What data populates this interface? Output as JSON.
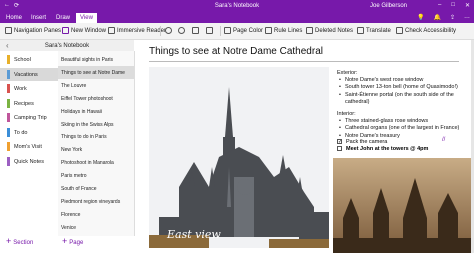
{
  "titlebar": {
    "title": "Sara's Notebook",
    "user": "Joe Gilberson"
  },
  "tabs": [
    {
      "label": "Home"
    },
    {
      "label": "Insert"
    },
    {
      "label": "Draw"
    },
    {
      "label": "View"
    }
  ],
  "ribbon": {
    "navigation_panes": "Navigation Panes",
    "new_window": "New Window",
    "immersive_reader": "Immersive Reader",
    "page_color": "Page Color",
    "rule_lines": "Rule Lines",
    "deleted_notes": "Deleted Notes",
    "translate": "Translate",
    "check_accessibility": "Check Accessibility"
  },
  "notebook": {
    "name": "Sara's Notebook"
  },
  "sections": [
    {
      "label": "School",
      "color": "#e8b02a"
    },
    {
      "label": "Vacations",
      "color": "#5b9bd5"
    },
    {
      "label": "Work",
      "color": "#d9534f"
    },
    {
      "label": "Recipes",
      "color": "#7bb342"
    },
    {
      "label": "Camping Trip",
      "color": "#c0569b"
    },
    {
      "label": "To do",
      "color": "#3b8ed8"
    },
    {
      "label": "Mom's Visit",
      "color": "#f0a030"
    },
    {
      "label": "Quick Notes",
      "color": "#9c5fc2"
    }
  ],
  "pages": [
    "Beautiful sights in Paris",
    "Things to see at Notre Dame",
    "The Louvre",
    "Eiffel Tower photoshoot",
    "Holidays in Hawaii",
    "Skiing in the Swiss Alps",
    "Things to do in Paris",
    "New York",
    "Photoshoot in Manarola",
    "Paris metro",
    "South of France",
    "Piedmont region vineyards",
    "Florence",
    "Venice"
  ],
  "bottom": {
    "add_section": "Section",
    "add_page": "Page"
  },
  "page": {
    "title": "Things to see at Notre Dame Cathedral",
    "photo_caption": "East view",
    "exterior_heading": "Exterior:",
    "exterior_items": [
      "Notre Dame's west rose window",
      "South tower 13-ton bell (home of Quasimodo!)",
      "Saint-Étienne portal (on the south side of the cathedral)"
    ],
    "interior_heading": "Interior:",
    "interior_items": [
      "Three stained-glass rose windows",
      "Cathedral organs (one of the largest in France)",
      "Notre Dame's treasury"
    ],
    "todos": [
      {
        "label": "Pack the camera",
        "checked": true
      },
      {
        "label": "Meet John at the towers @ 4pm",
        "checked": false
      }
    ],
    "todo_mark": "✓",
    "side_mark": "//"
  },
  "colors": {
    "accent": "#7719aa"
  }
}
